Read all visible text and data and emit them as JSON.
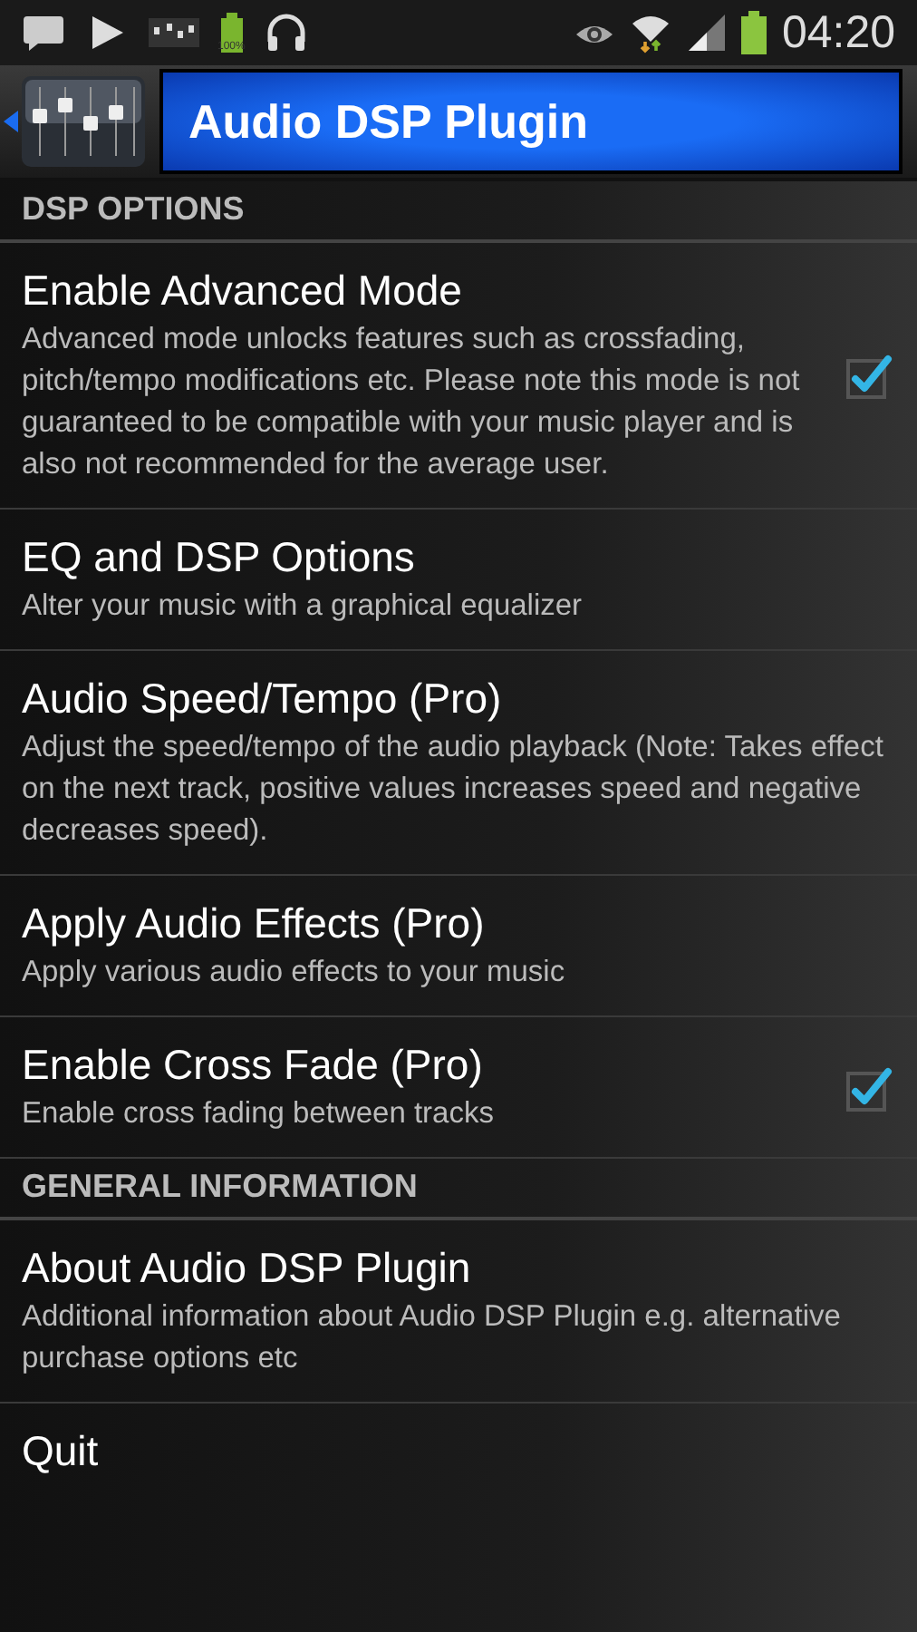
{
  "status_bar": {
    "battery_label": "100%",
    "time": "04:20"
  },
  "header": {
    "title": "Audio DSP Plugin"
  },
  "sections": [
    {
      "title": "DSP OPTIONS",
      "items": [
        {
          "kind": "checkbox",
          "title": "Enable Advanced Mode",
          "summary": "Advanced mode unlocks features such as crossfading, pitch/tempo modifications etc. Please note this mode is not guaranteed to be compatible with your music player and is also not recommended for the average user.",
          "checked": true
        },
        {
          "kind": "plain",
          "title": "EQ and DSP Options",
          "summary": "Alter your music with a graphical equalizer"
        },
        {
          "kind": "plain",
          "title": "Audio Speed/Tempo (Pro)",
          "summary": "Adjust the speed/tempo of the audio playback (Note: Takes effect on the next track, positive values increases speed and negative decreases speed)."
        },
        {
          "kind": "plain",
          "title": "Apply Audio Effects (Pro)",
          "summary": "Apply various audio effects to your music"
        },
        {
          "kind": "checkbox",
          "title": "Enable Cross Fade (Pro)",
          "summary": "Enable cross fading between tracks",
          "checked": true
        }
      ]
    },
    {
      "title": "GENERAL INFORMATION",
      "items": [
        {
          "kind": "plain",
          "title": "About Audio DSP Plugin",
          "summary": "Additional information about Audio DSP Plugin e.g. alternative purchase options etc"
        },
        {
          "kind": "plain",
          "title": "Quit"
        }
      ]
    }
  ]
}
